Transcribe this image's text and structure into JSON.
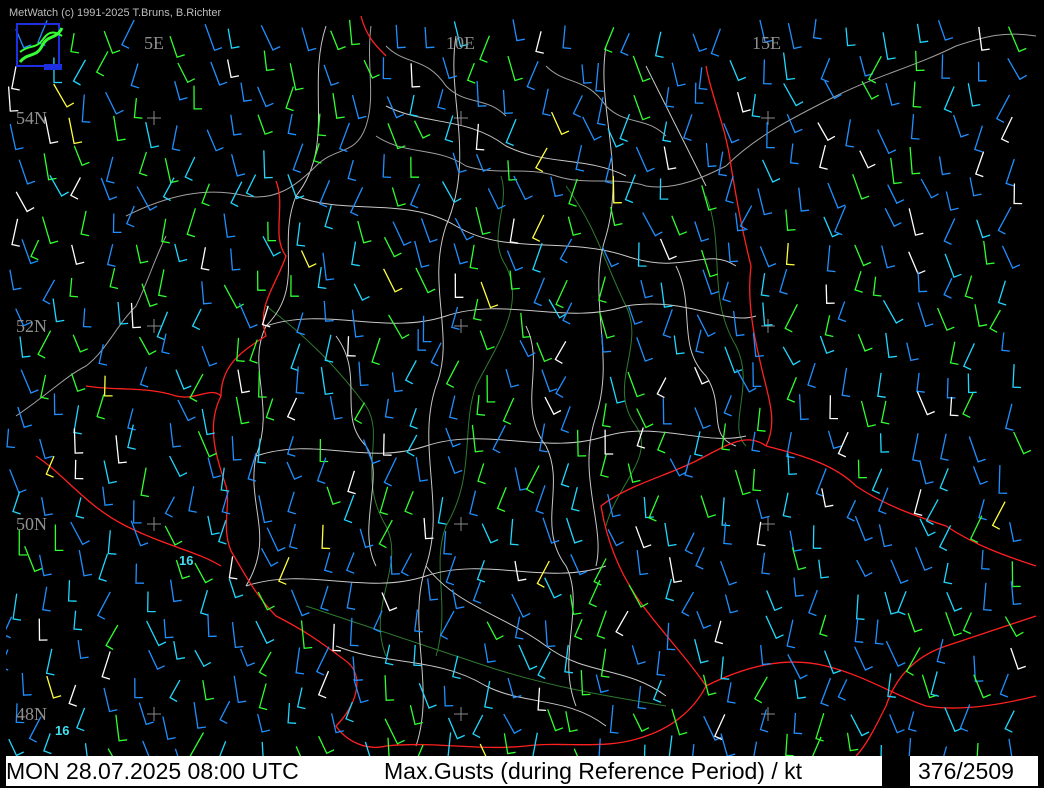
{
  "credit": "MetWatch  (c) 1991-2025 T.Bruns, B.Richter",
  "logo_icon": "metwatch-logo-icon",
  "lon_labels": [
    "5E",
    "10E",
    "15E"
  ],
  "lat_labels": [
    "54N",
    "52N",
    "50N",
    "48N"
  ],
  "station_values": [
    "16",
    "16"
  ],
  "footer": {
    "datetime": "MON 28.07.2025 08:00 UTC",
    "product": "Max.Gusts (during Reference Period) / kt",
    "count": "376/2509"
  },
  "colors": {
    "background": "#000000",
    "national_borders": "#ff2020",
    "state_borders": "#c8c8c8",
    "rivers": "#2f7a2f",
    "wind_speed_classes": [
      "#1f8fff",
      "#20d8ff",
      "#30ff30",
      "#ffffff",
      "#ffff40"
    ]
  }
}
